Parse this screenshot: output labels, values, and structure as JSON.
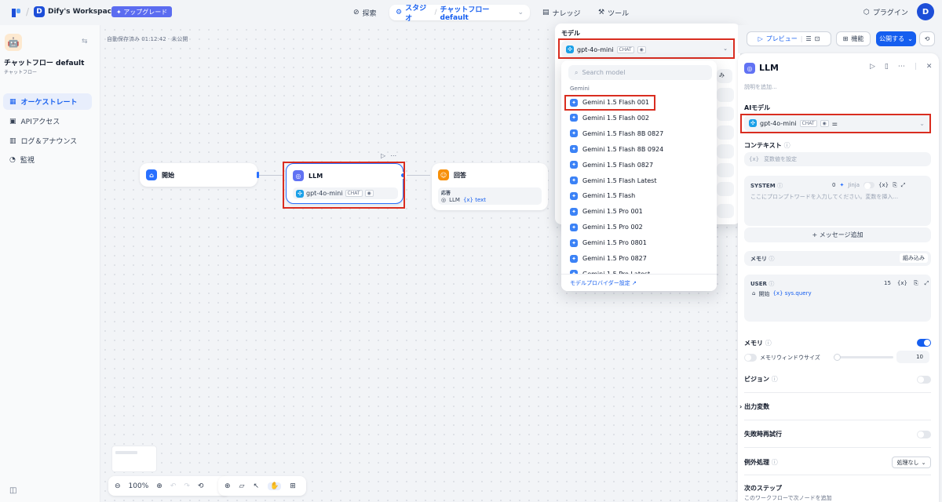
{
  "topbar": {
    "workspace_initial": "D",
    "workspace_name": "Dify's Workspace",
    "upgrade": "アップグレード",
    "nav_explore": "探索",
    "nav_studio": "スタジオ",
    "nav_app": "チャットフロー default",
    "nav_knowledge": "ナレッジ",
    "nav_tools": "ツール",
    "plugins": "プラグイン",
    "avatar": "D"
  },
  "sidebar": {
    "app_title": "チャットフロー default",
    "app_sub": "チャットフロー",
    "items": [
      {
        "label": "オーケストレート"
      },
      {
        "label": "APIアクセス"
      },
      {
        "label": "ログ＆アナウンス"
      },
      {
        "label": "監視"
      }
    ]
  },
  "canvas": {
    "autosave": "自動保存済み 01:12:42 · 未公開",
    "start_node": "開始",
    "llm_node": "LLM",
    "llm_model": "gpt-4o-mini",
    "llm_tag": "CHAT",
    "answer_node": "回答",
    "answer_label": "応答",
    "answer_var_src": "LLM",
    "answer_var": "text",
    "zoom": "100%"
  },
  "model_dropdown": {
    "label": "モデル",
    "selected": "gpt-4o-mini",
    "tag": "CHAT",
    "search_placeholder": "Search model",
    "group": "Gemini",
    "models": [
      "Gemini 1.5 Flash 001",
      "Gemini 1.5 Flash 002",
      "Gemini 1.5 Flash 8B 0827",
      "Gemini 1.5 Flash 8B 0924",
      "Gemini 1.5 Flash 0827",
      "Gemini 1.5 Flash Latest",
      "Gemini 1.5 Flash",
      "Gemini 1.5 Pro 001",
      "Gemini 1.5 Pro 002",
      "Gemini 1.5 Pro 0801",
      "Gemini 1.5 Pro 0827",
      "Gemini 1.5 Pro Latest"
    ],
    "footer": "モデルプロバイダー設定 ↗",
    "behind_badge": "み"
  },
  "panel": {
    "preview": "プレビュー",
    "features": "機能",
    "publish": "公開する",
    "title": "LLM",
    "desc": "説明を追加...",
    "ai_model_label": "AIモデル",
    "model": "gpt-4o-mini",
    "model_tag": "CHAT",
    "context_label": "コンテキスト",
    "context_placeholder": "変数値を設定",
    "system_label": "SYSTEM",
    "system_count": "0",
    "system_jinja": "Jinja",
    "system_placeholder": "ここにプロンプトワードを入力してください。変数を挿入...",
    "add_message": "+ メッセージ追加",
    "memory_label": "メモリ",
    "builtin": "組み込み",
    "user_label": "USER",
    "user_count": "15",
    "user_var_src": "開始",
    "user_var": "sys.query",
    "memory2_label": "メモリ",
    "window_label": "メモリウィンドウサイズ",
    "window_value": "10",
    "vision_label": "ビジョン",
    "output_label": "出力変数",
    "retry_label": "失敗時再試行",
    "exception_label": "例外処理",
    "exception_value": "処理なし",
    "next_step_label": "次のステップ",
    "next_step_desc": "このワークフローで次ノードを追加"
  }
}
